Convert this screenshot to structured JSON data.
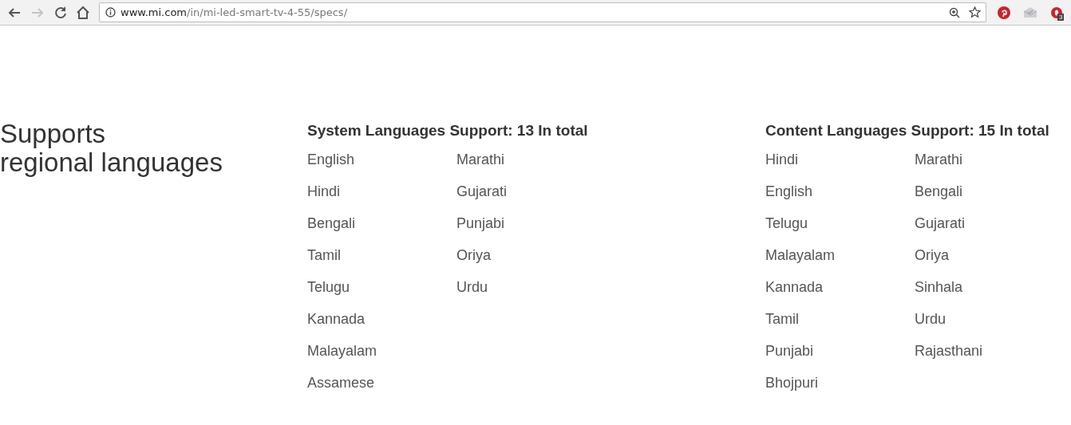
{
  "browser": {
    "back": {
      "disabled": false
    },
    "forward": {
      "disabled": true
    },
    "url_host": "www.mi.com",
    "url_path": "/in/mi-led-smart-tv-4-55/specs/",
    "extension_badge": "3"
  },
  "section": {
    "heading_lines": [
      "Supports",
      "regional languages"
    ],
    "groups": [
      {
        "title": "System Languages Support: 13 In total",
        "columns": [
          [
            "English",
            "Hindi",
            "Bengali",
            "Tamil",
            "Telugu",
            "Kannada",
            "Malayalam",
            "Assamese"
          ],
          [
            "Marathi",
            "Gujarati",
            "Punjabi",
            "Oriya",
            "Urdu"
          ]
        ]
      },
      {
        "title": "Content Languages Support: 15 In total",
        "columns": [
          [
            "Hindi",
            "English",
            "Telugu",
            "Malayalam",
            "Kannada",
            "Tamil",
            "Punjabi",
            "Bhojpuri"
          ],
          [
            "Marathi",
            "Bengali",
            "Gujarati",
            "Oriya",
            "Sinhala",
            "Urdu",
            "Rajasthani"
          ]
        ]
      }
    ]
  }
}
